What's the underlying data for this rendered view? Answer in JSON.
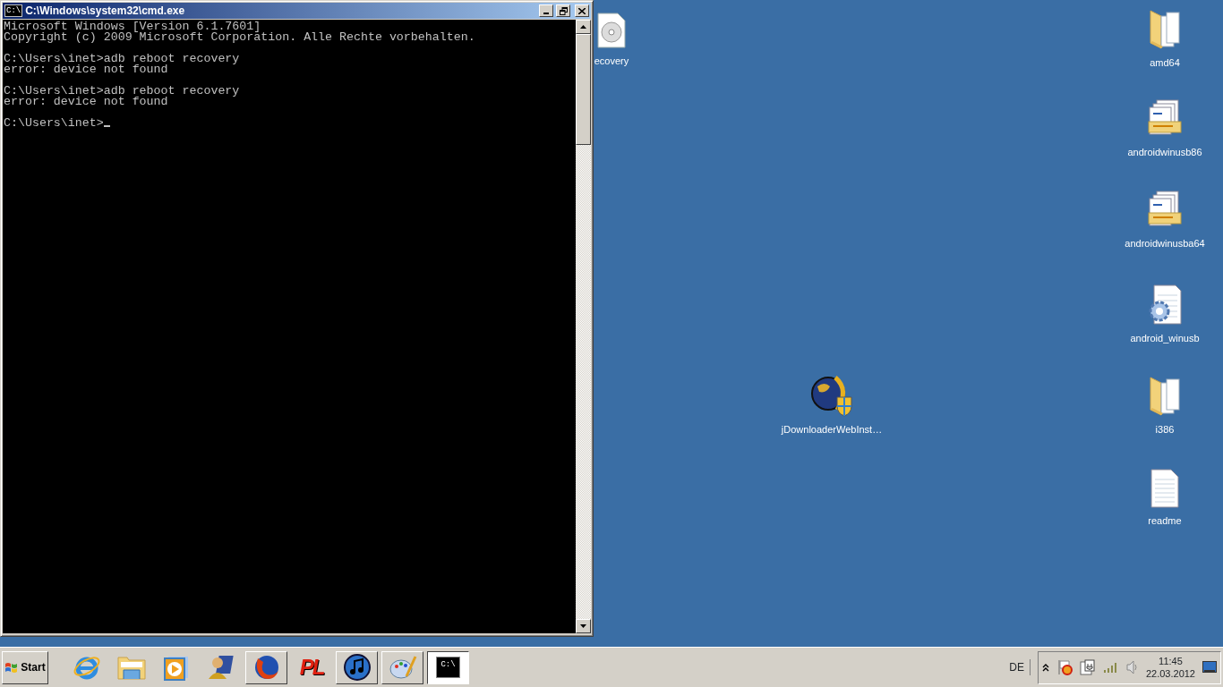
{
  "window": {
    "title": "C:\\Windows\\system32\\cmd.exe",
    "app_icon": "C:\\",
    "console": [
      [
        "Microsoft Windows [Version 6.1.7601]",
        "Copyright (c) 2009 Microsoft Corporation. Alle Rechte vorbehalten."
      ],
      [
        "C:\\Users\\inet>adb reboot recovery",
        "error: device not found"
      ],
      [
        "C:\\Users\\inet>adb reboot recovery",
        "error: device not found"
      ],
      [
        "C:\\Users\\inet>"
      ]
    ],
    "cursor": true
  },
  "desktop_icons": [
    {
      "label": "ecovery",
      "kind": "disc"
    },
    {
      "label": "amd64",
      "kind": "folder"
    },
    {
      "label": "androidwinusb86",
      "kind": "setup"
    },
    {
      "label": "androidwinusba64",
      "kind": "setup"
    },
    {
      "label": "android_winusb",
      "kind": "config"
    },
    {
      "label": "jDownloaderWebInst…",
      "kind": "globe"
    },
    {
      "label": "i386",
      "kind": "folder"
    },
    {
      "label": "readme",
      "kind": "text"
    }
  ],
  "taskbar": {
    "start": "Start",
    "items": [
      {
        "kind": "ie",
        "framed": false,
        "selected": false
      },
      {
        "kind": "explorer",
        "framed": false,
        "selected": false
      },
      {
        "kind": "media",
        "framed": false,
        "selected": false
      },
      {
        "kind": "person",
        "framed": false,
        "selected": false
      },
      {
        "kind": "firefox",
        "framed": true,
        "selected": false
      },
      {
        "kind": "pl",
        "label": "PL",
        "framed": false,
        "selected": false
      },
      {
        "kind": "music",
        "framed": true,
        "selected": false
      },
      {
        "kind": "paint",
        "framed": true,
        "selected": false
      },
      {
        "kind": "console",
        "label": "C:\\",
        "framed": true,
        "selected": true
      }
    ],
    "language": "DE",
    "time": "11:45",
    "date": "22.03.2012"
  }
}
